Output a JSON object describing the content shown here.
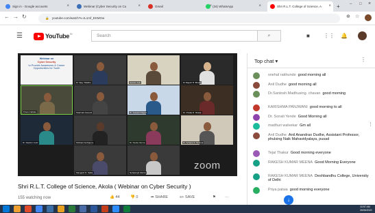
{
  "browser": {
    "tabs": [
      {
        "label": "Sign in - Google accounts"
      },
      {
        "label": "Webinar (Cyber Security on Cu"
      },
      {
        "label": "Gmail"
      },
      {
        "label": "(34) WhatsApp"
      },
      {
        "label": "Shri R.L.T. College of Science, A"
      }
    ],
    "new_tab": "+",
    "url": "youtube.com/watch?v=IL1mf_EKMGw"
  },
  "youtube": {
    "logo_text": "YouTube",
    "logo_country": "IN",
    "search_placeholder": "Search"
  },
  "video": {
    "slide_lines": [
      "Webinar on",
      "Cyber Security",
      "to Provide Awareness & Career",
      "Opportunities for Youth"
    ],
    "participants": [
      {
        "name": "Pravin Nahida"
      },
      {
        "name": "Dr Vijay Tidakhe"
      },
      {
        "name": "Gaurav Jain"
      },
      {
        "name": "Dr.Rajesh B. Bhadu"
      },
      {
        "name": "Pravat Mahakud"
      },
      {
        "name": "Shahnak Gavand"
      },
      {
        "name": "Dr. Jaswant Rajput"
      },
      {
        "name": "Dr. Pradip R. Rawat"
      },
      {
        "name": "Dr. Rashmi Joshi"
      },
      {
        "name": "Shrikant Ambapure"
      },
      {
        "name": "Dr. Kavita Verma"
      },
      {
        "name": "Dr. Achana S. Shrimal"
      },
      {
        "name": "Mangesh N. Sable"
      },
      {
        "name": "Nehasingh Mehta"
      }
    ],
    "watermark": "zoom",
    "title": "Shri R.L.T. College of Science, Akola ( Webinar on Cyber Security )",
    "watching": "155 watching now",
    "likes": "44",
    "dislikes": "0",
    "share_label": "SHARE",
    "save_label": "SAVE"
  },
  "chat": {
    "header": "Top chat",
    "messages": [
      {
        "author": "snehal rakhunde",
        "text": "good morning all",
        "color": "#6a8f5a"
      },
      {
        "author": "Anil Dudhe",
        "text": "good morning all",
        "color": "#8b4a3b"
      },
      {
        "author": "Dr.Santosh.Madhusing. chavan",
        "text": "good morning",
        "color": "#6a8f5a"
      },
      {
        "author": "KARISHMA PANJWANI",
        "text": "good morning to all",
        "color": "#c0392b"
      },
      {
        "author": "Dr. Sonali Yende",
        "text": "Good Morning all",
        "color": "#8e44ad"
      },
      {
        "author": "madhuri walvekar",
        "text": "Gm all",
        "color": "#1abc9c"
      },
      {
        "author": "Anil Dudhe",
        "text": "Anil Anandrao Dudhe, Assistant Professor, phulsing Naik Mahavidyalaya, pusad",
        "color": "#8b4a3b"
      },
      {
        "author": "Tejal Thakur",
        "text": "Good morning everyone",
        "color": "#9b59b6"
      },
      {
        "author": "RAKESH KUMAR MEENA",
        "text": "Good Morning Everyone",
        "color": "#16a085"
      },
      {
        "author": "RAKESH KUMAR MEENA",
        "text": "Deshbandhu College, University of Delhi",
        "color": "#16a085"
      },
      {
        "author": "Priya patwa",
        "text": "good morning everyone",
        "color": "#27ae60"
      }
    ]
  },
  "taskbar": {
    "time": "10:57 AM",
    "date": "26/06/2020"
  }
}
